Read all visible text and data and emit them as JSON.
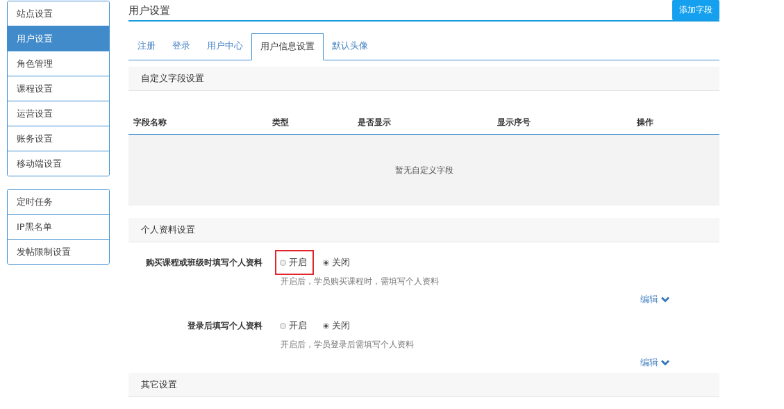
{
  "sidebar": {
    "groups": [
      {
        "items": [
          {
            "label": "站点设置",
            "selected": false
          },
          {
            "label": "用户设置",
            "selected": true
          },
          {
            "label": "角色管理",
            "selected": false
          },
          {
            "label": "课程设置",
            "selected": false
          },
          {
            "label": "运营设置",
            "selected": false
          },
          {
            "label": "账务设置",
            "selected": false
          },
          {
            "label": "移动端设置",
            "selected": false
          }
        ]
      },
      {
        "items": [
          {
            "label": "定时任务",
            "selected": false
          },
          {
            "label": "IP黑名单",
            "selected": false
          },
          {
            "label": "发帖限制设置",
            "selected": false
          }
        ]
      }
    ]
  },
  "page": {
    "title": "用户设置",
    "action": "添加字段"
  },
  "tabs": [
    {
      "label": "注册",
      "selected": false
    },
    {
      "label": "登录",
      "selected": false
    },
    {
      "label": "用户中心",
      "selected": false
    },
    {
      "label": "用户信息设置",
      "selected": true
    },
    {
      "label": "默认头像",
      "selected": false
    }
  ],
  "custom_fields": {
    "heading": "自定义字段设置",
    "columns": [
      "字段名称",
      "类型",
      "是否显示",
      "显示序号",
      "操作"
    ],
    "empty": "暂无自定义字段"
  },
  "profile": {
    "heading": "个人资料设置",
    "settings": [
      {
        "label": "购买课程或班级时填写个人资料",
        "options": [
          {
            "label": "开启",
            "selected": false,
            "highlighted": true
          },
          {
            "label": "关闭",
            "selected": true,
            "highlighted": false
          }
        ],
        "help": "开启后，学员购买课程时，需填写个人资料",
        "edit": "编辑"
      },
      {
        "label": "登录后填写个人资料",
        "options": [
          {
            "label": "开启",
            "selected": false,
            "highlighted": false
          },
          {
            "label": "关闭",
            "selected": true,
            "highlighted": false
          }
        ],
        "help": "开启后，学员登录后需填写个人资料",
        "edit": "编辑"
      }
    ]
  },
  "other": {
    "heading": "其它设置"
  }
}
